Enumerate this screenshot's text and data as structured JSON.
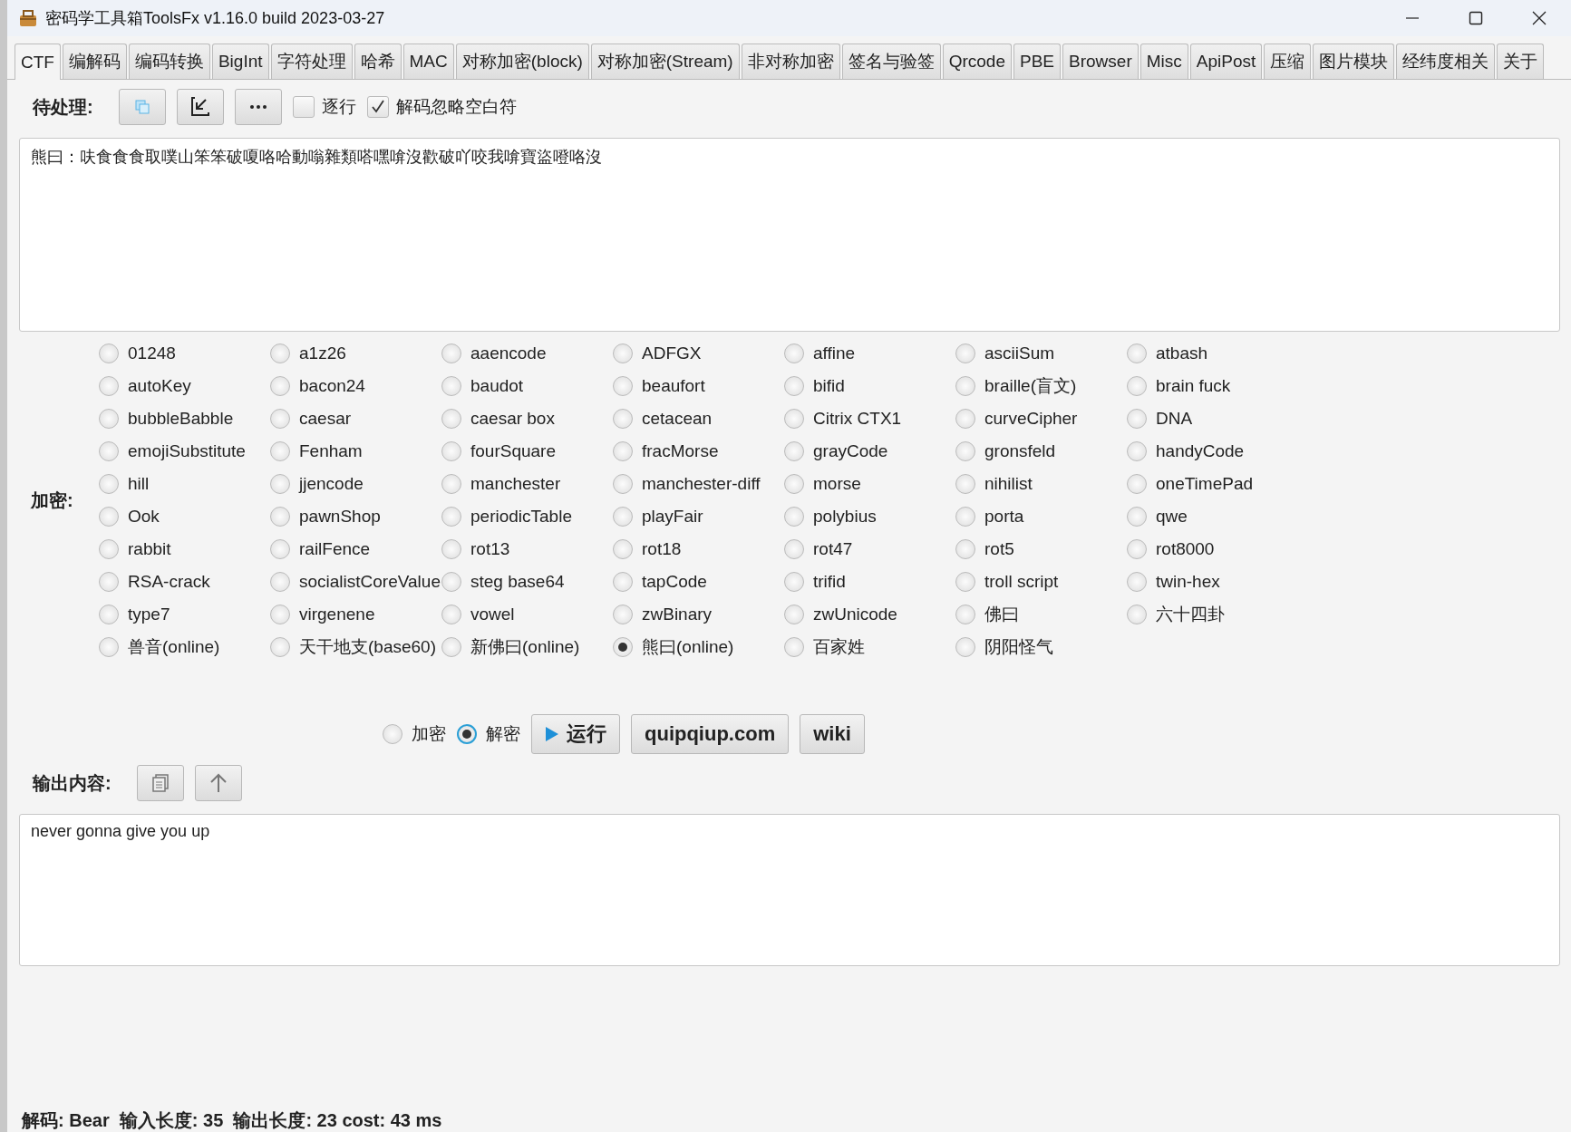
{
  "window": {
    "title": "密码学工具箱ToolsFx v1.16.0 build 2023-03-27"
  },
  "tabs": [
    {
      "label": "CTF",
      "selected": true
    },
    {
      "label": "编解码",
      "selected": false
    },
    {
      "label": "编码转换",
      "selected": false
    },
    {
      "label": "BigInt",
      "selected": false
    },
    {
      "label": "字符处理",
      "selected": false
    },
    {
      "label": "哈希",
      "selected": false
    },
    {
      "label": "MAC",
      "selected": false
    },
    {
      "label": "对称加密(block)",
      "selected": false
    },
    {
      "label": "对称加密(Stream)",
      "selected": false
    },
    {
      "label": "非对称加密",
      "selected": false
    },
    {
      "label": "签名与验签",
      "selected": false
    },
    {
      "label": "Qrcode",
      "selected": false
    },
    {
      "label": "PBE",
      "selected": false
    },
    {
      "label": "Browser",
      "selected": false
    },
    {
      "label": "Misc",
      "selected": false
    },
    {
      "label": "ApiPost",
      "selected": false
    },
    {
      "label": "压缩",
      "selected": false
    },
    {
      "label": "图片模块",
      "selected": false
    },
    {
      "label": "经纬度相关",
      "selected": false
    },
    {
      "label": "关于",
      "selected": false
    }
  ],
  "input_toolbar": {
    "label": "待处理:",
    "checkboxes": [
      {
        "label": "逐行",
        "checked": false
      },
      {
        "label": "解码忽略空白符",
        "checked": true
      }
    ]
  },
  "input": {
    "value": "熊曰：呋食食食取噗山笨笨破嗄咯哈動嗡雜類嗒嘿啽沒歡破吖咬我啽寶盜噔咯沒"
  },
  "cipher": {
    "label": "加密:",
    "options": [
      {
        "label": "01248",
        "selected": false
      },
      {
        "label": "a1z26",
        "selected": false
      },
      {
        "label": "aaencode",
        "selected": false
      },
      {
        "label": "ADFGX",
        "selected": false
      },
      {
        "label": "affine",
        "selected": false
      },
      {
        "label": "asciiSum",
        "selected": false
      },
      {
        "label": "atbash",
        "selected": false
      },
      {
        "label": "autoKey",
        "selected": false
      },
      {
        "label": "bacon24",
        "selected": false
      },
      {
        "label": "baudot",
        "selected": false
      },
      {
        "label": "beaufort",
        "selected": false
      },
      {
        "label": "bifid",
        "selected": false
      },
      {
        "label": "braille(盲文)",
        "selected": false
      },
      {
        "label": "brain fuck",
        "selected": false
      },
      {
        "label": "bubbleBabble",
        "selected": false
      },
      {
        "label": "caesar",
        "selected": false
      },
      {
        "label": "caesar box",
        "selected": false
      },
      {
        "label": "cetacean",
        "selected": false
      },
      {
        "label": "Citrix CTX1",
        "selected": false
      },
      {
        "label": "curveCipher",
        "selected": false
      },
      {
        "label": "DNA",
        "selected": false
      },
      {
        "label": "emojiSubstitute",
        "selected": false
      },
      {
        "label": "Fenham",
        "selected": false
      },
      {
        "label": "fourSquare",
        "selected": false
      },
      {
        "label": "fracMorse",
        "selected": false
      },
      {
        "label": "grayCode",
        "selected": false
      },
      {
        "label": "gronsfeld",
        "selected": false
      },
      {
        "label": "handyCode",
        "selected": false
      },
      {
        "label": "hill",
        "selected": false
      },
      {
        "label": "jjencode",
        "selected": false
      },
      {
        "label": "manchester",
        "selected": false
      },
      {
        "label": "manchester-diff",
        "selected": false
      },
      {
        "label": "morse",
        "selected": false
      },
      {
        "label": "nihilist",
        "selected": false
      },
      {
        "label": "oneTimePad",
        "selected": false
      },
      {
        "label": "Ook",
        "selected": false
      },
      {
        "label": "pawnShop",
        "selected": false
      },
      {
        "label": "periodicTable",
        "selected": false
      },
      {
        "label": "playFair",
        "selected": false
      },
      {
        "label": "polybius",
        "selected": false
      },
      {
        "label": "porta",
        "selected": false
      },
      {
        "label": "qwe",
        "selected": false
      },
      {
        "label": "rabbit",
        "selected": false
      },
      {
        "label": "railFence",
        "selected": false
      },
      {
        "label": "rot13",
        "selected": false
      },
      {
        "label": "rot18",
        "selected": false
      },
      {
        "label": "rot47",
        "selected": false
      },
      {
        "label": "rot5",
        "selected": false
      },
      {
        "label": "rot8000",
        "selected": false
      },
      {
        "label": "RSA-crack",
        "selected": false
      },
      {
        "label": "socialistCoreValue",
        "selected": false
      },
      {
        "label": "steg base64",
        "selected": false
      },
      {
        "label": "tapCode",
        "selected": false
      },
      {
        "label": "trifid",
        "selected": false
      },
      {
        "label": "troll script",
        "selected": false
      },
      {
        "label": "twin-hex",
        "selected": false
      },
      {
        "label": "type7",
        "selected": false
      },
      {
        "label": "virgenene",
        "selected": false
      },
      {
        "label": "vowel",
        "selected": false
      },
      {
        "label": "zwBinary",
        "selected": false
      },
      {
        "label": "zwUnicode",
        "selected": false
      },
      {
        "label": "佛曰",
        "selected": false
      },
      {
        "label": "六十四卦",
        "selected": false
      },
      {
        "label": "兽音(online)",
        "selected": false
      },
      {
        "label": "天干地支(base60)",
        "selected": false
      },
      {
        "label": "新佛曰(online)",
        "selected": false
      },
      {
        "label": "熊曰(online)",
        "selected": true
      },
      {
        "label": "百家姓",
        "selected": false
      },
      {
        "label": "阴阳怪气",
        "selected": false
      }
    ]
  },
  "mode": [
    {
      "label": "加密",
      "selected": false
    },
    {
      "label": "解密",
      "selected": true
    }
  ],
  "actions": [
    {
      "label": "运行",
      "kind": "run"
    },
    {
      "label": "quipqiup.com",
      "kind": "plain"
    },
    {
      "label": "wiki",
      "kind": "plain"
    }
  ],
  "output_toolbar": {
    "label": "输出内容:"
  },
  "output": {
    "value": "never gonna give you up"
  },
  "status_bar": "解码: Bear  输入长度: 35  输出长度: 23 cost: 43 ms"
}
